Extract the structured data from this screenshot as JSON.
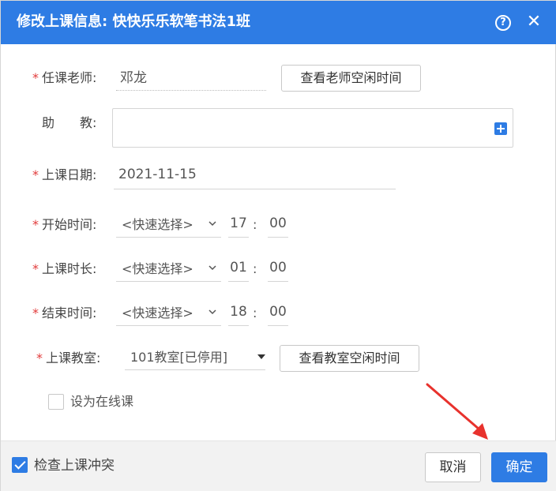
{
  "dialog": {
    "title": "修改上课信息: 快快乐乐软笔书法1班",
    "help_glyph": "?",
    "close_glyph": "✕"
  },
  "form": {
    "teacher": {
      "label": "任课老师:",
      "value": "邓龙",
      "button_label": "查看老师空闲时间"
    },
    "assistant": {
      "label": "助　　教:"
    },
    "date": {
      "label": "上课日期:",
      "value": "2021-11-15"
    },
    "start_time": {
      "label": "开始时间:",
      "select": "<快速选择>",
      "hour": "17",
      "minute": "00"
    },
    "duration": {
      "label": "上课时长:",
      "select": "<快速选择>",
      "hour": "01",
      "minute": "00"
    },
    "end_time": {
      "label": "结束时间:",
      "select": "<快速选择>",
      "hour": "18",
      "minute": "00"
    },
    "classroom": {
      "label": "上课教室:",
      "value": "101教室[已停用]",
      "button_label": "查看教室空闲时间"
    },
    "online": {
      "label": "设为在线课",
      "checked": false
    },
    "required_mark": "*",
    "colon": ":"
  },
  "footer": {
    "check_conflict_label": "检查上课冲突",
    "check_conflict_checked": true,
    "cancel_label": "取消",
    "confirm_label": "确定"
  },
  "colors": {
    "accent": "#2e7ce4",
    "required": "#e23b3b",
    "annotation_arrow": "#e8322d"
  },
  "icons": {
    "help": "question-circle-icon",
    "close": "close-icon",
    "add": "plus-square-icon",
    "dropdown": "chevron-down-icon",
    "caret": "caret-down-icon"
  }
}
